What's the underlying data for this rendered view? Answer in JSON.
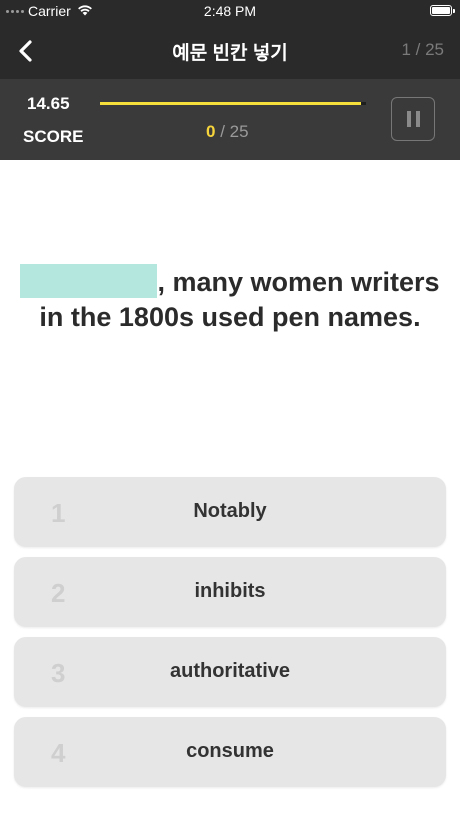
{
  "status_bar": {
    "carrier": "Carrier",
    "time": "2:48 PM",
    "wifi_icon": "wifi-icon",
    "battery_icon": "battery-icon"
  },
  "nav": {
    "back_icon": "chevron-left-icon",
    "title": "예문 빈칸 넣기",
    "counter": "1 / 25"
  },
  "score_panel": {
    "score_value": "14.65",
    "score_label": "SCORE",
    "timer_remaining_fraction": 0.98,
    "timer_color": "#f6df3b",
    "progress_current": "0",
    "progress_separator": "/",
    "progress_total": "25",
    "pause_icon": "pause-icon"
  },
  "question": {
    "blank_color": "#b4e8df",
    "text_after_blank": ", many women writers in the 1800s used pen names."
  },
  "options": [
    {
      "number": "1",
      "text": "Notably"
    },
    {
      "number": "2",
      "text": "inhibits"
    },
    {
      "number": "3",
      "text": "authoritative"
    },
    {
      "number": "4",
      "text": "consume"
    }
  ]
}
